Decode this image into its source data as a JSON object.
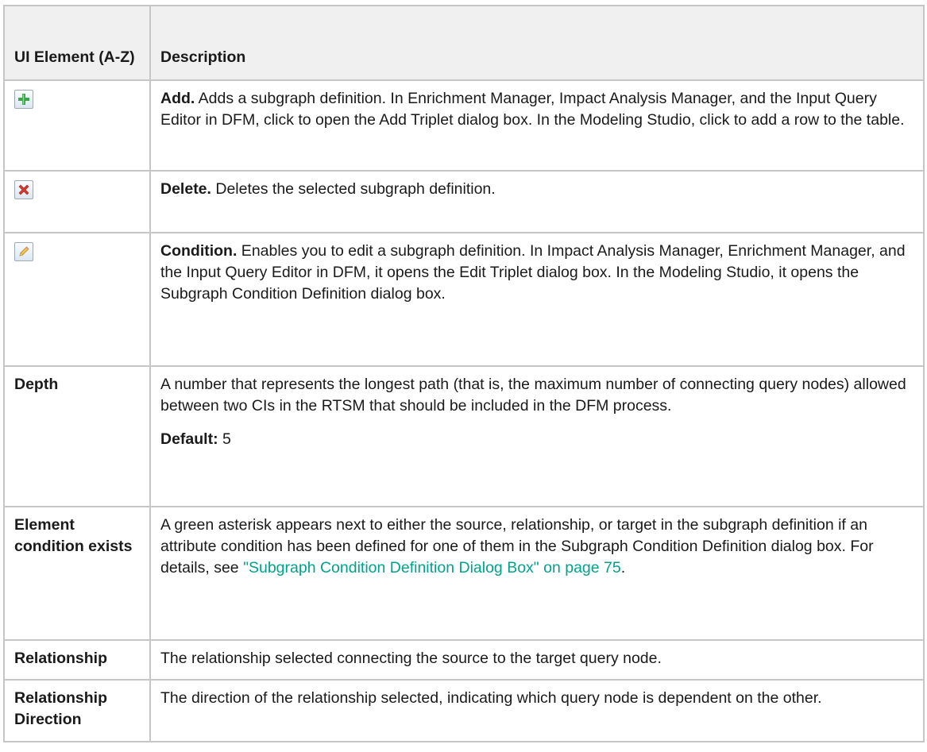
{
  "header": {
    "col1": "UI Element (A-Z)",
    "col2": "Description"
  },
  "rows": {
    "add": {
      "icon": "add-plus-icon",
      "term": "Add.",
      "text": " Adds a subgraph definition. In Enrichment Manager, Impact Analysis Manager, and the Input Query Editor in DFM, click to open the Add Triplet dialog box. In the Modeling Studio, click to add a row to the table."
    },
    "delete": {
      "icon": "delete-x-icon",
      "term": "Delete.",
      "text": " Deletes the selected subgraph definition."
    },
    "condition": {
      "icon": "pencil-edit-icon",
      "term": "Condition.",
      "text": " Enables you to edit a subgraph definition. In Impact Analysis Manager, Enrichment Manager, and the Input Query Editor in DFM, it opens the Edit Triplet dialog box. In the Modeling Studio, it opens the Subgraph Condition Definition dialog box."
    },
    "depth": {
      "name": "Depth",
      "text": "A number that represents the longest path (that is, the maximum number of connecting query nodes) allowed between two CIs in the RTSM that should be included in the DFM process.",
      "default_label": "Default:",
      "default_value": " 5"
    },
    "exists": {
      "name": "Element condition exists",
      "text": "A green asterisk appears next to either the source, relationship, or target in the subgraph definition if an attribute condition has been defined for one of them in the Subgraph Condition Definition dialog box. For details, see ",
      "link": "\"Subgraph Condition Definition Dialog Box\" on page 75",
      "after": "."
    },
    "relationship": {
      "name": "Relationship",
      "text": "The relationship selected connecting the source to the target query node."
    },
    "direction": {
      "name": "Relationship Direction",
      "text": "The direction of the relationship selected, indicating which query node is dependent on the other."
    }
  },
  "colors": {
    "link": "#00a38a",
    "header_bg": "#f0f0f0",
    "border": "#c6c6c6"
  }
}
